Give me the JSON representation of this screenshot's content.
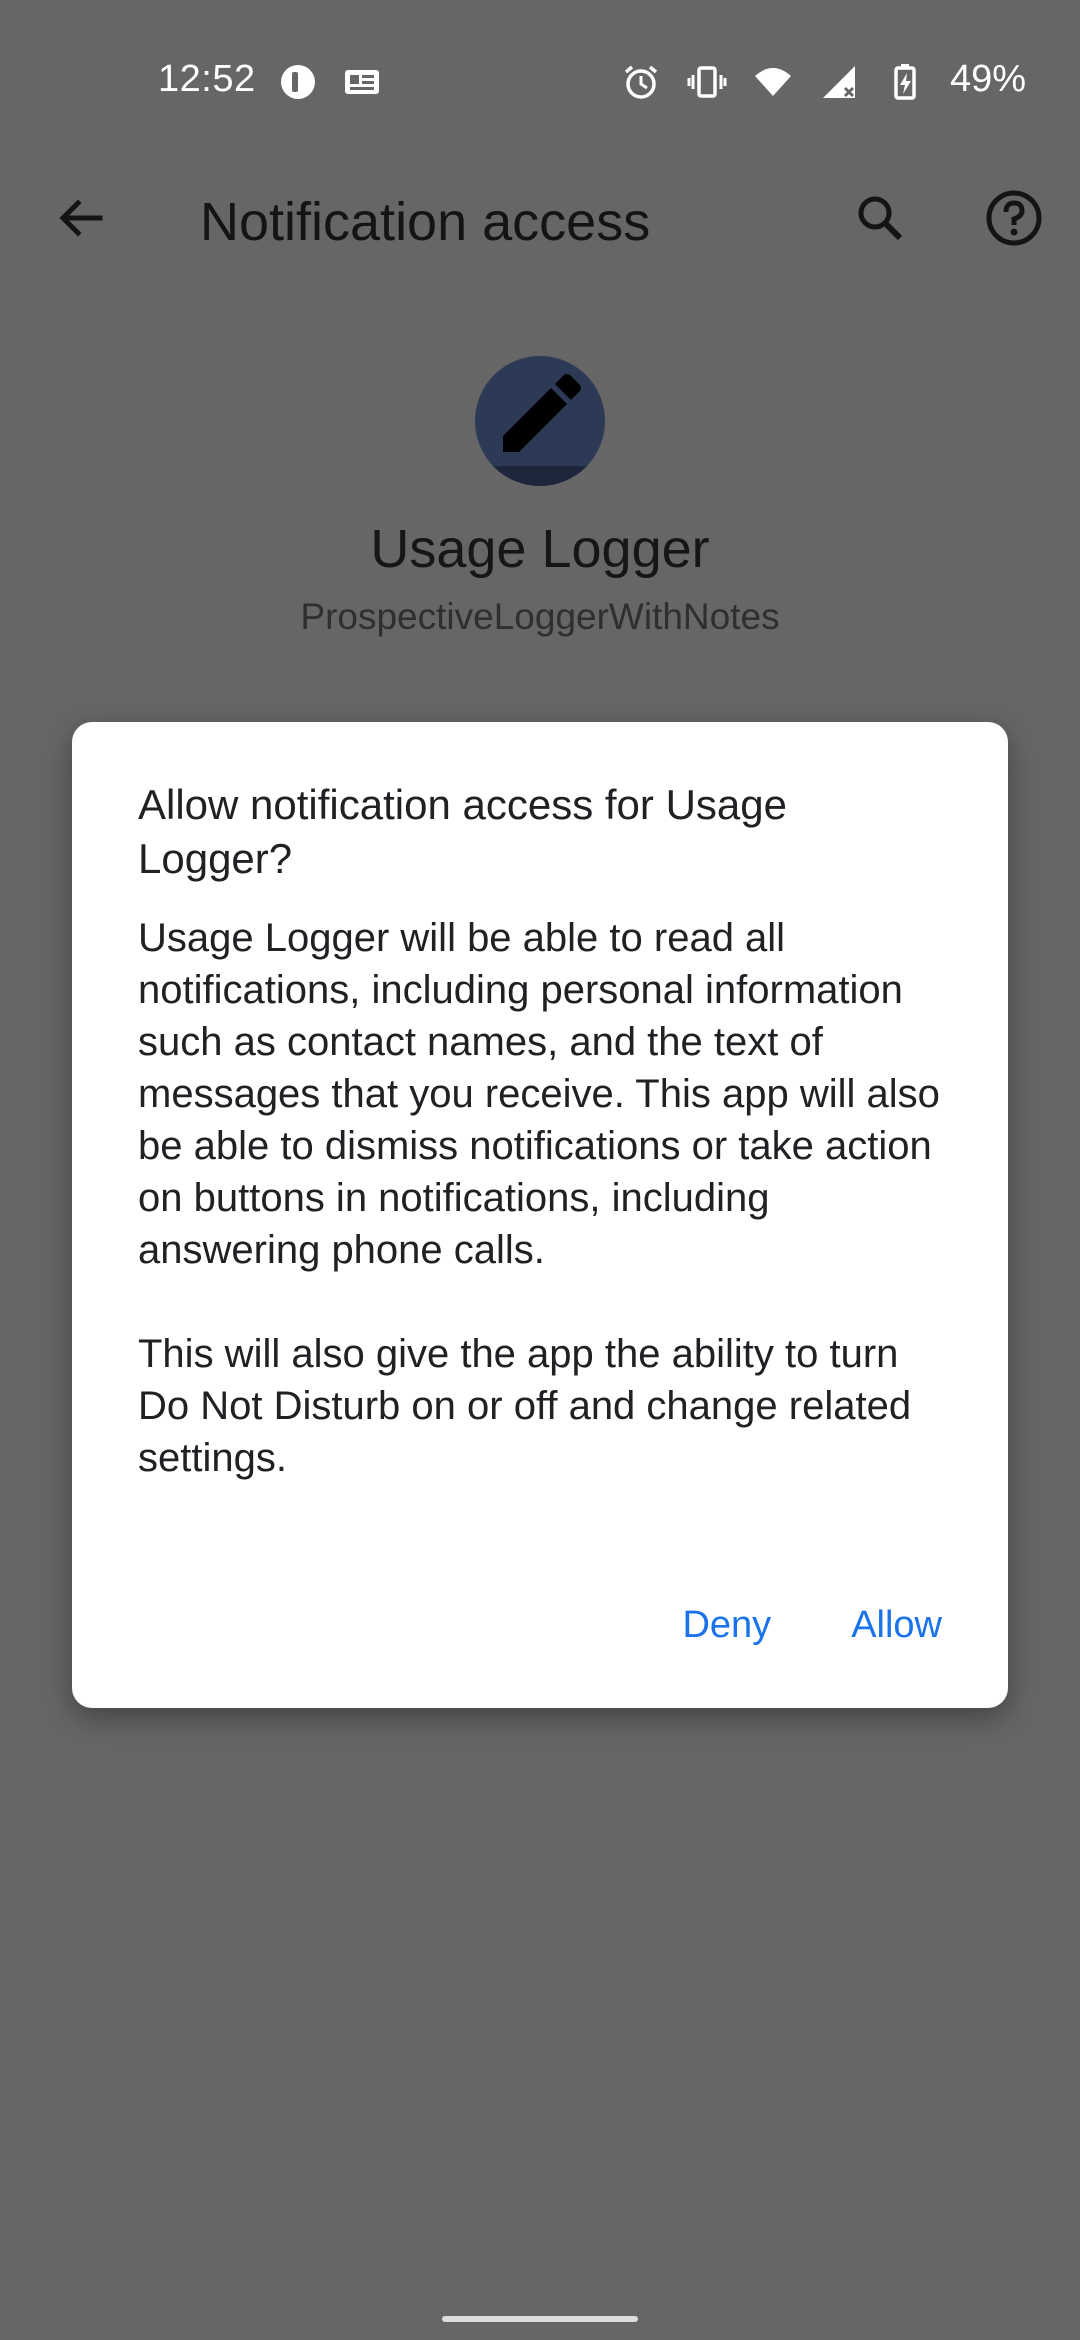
{
  "status_bar": {
    "time": "12:52",
    "battery_percent": "49%",
    "left_icons": [
      "app-notification-icon",
      "news-icon"
    ],
    "right_icons": [
      "alarm-icon",
      "vibrate-icon",
      "wifi-icon",
      "cell-signal-icon",
      "battery-charging-icon"
    ]
  },
  "app_bar": {
    "title": "Notification access",
    "back_icon": "back-arrow-icon",
    "search_icon": "search-icon",
    "help_icon": "help-icon"
  },
  "app_header": {
    "name": "Usage Logger",
    "package": "ProspectiveLoggerWithNotes",
    "icon": "pencil-icon"
  },
  "dialog": {
    "title": "Allow notification access for Usage Logger?",
    "body_paragraph_1": "Usage Logger will be able to read all notifications, including personal information such as contact names, and the text of messages that you receive. This app will also be able to dismiss notifications or take action on buttons in notifications, including answering phone calls.",
    "body_paragraph_2": "This will also give the app the ability to turn Do Not Disturb on or off and change related settings.",
    "deny_label": "Deny",
    "allow_label": "Allow"
  },
  "colors": {
    "scrim": "#666666",
    "dialog_bg": "#ffffff",
    "accent": "#1a73e8",
    "avatar_bg": "#2c3a55"
  }
}
